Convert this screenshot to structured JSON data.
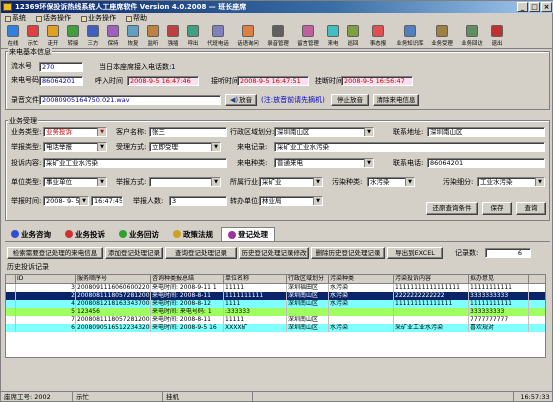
{
  "window": {
    "title": "12369环保投诉热线系统人工座席软件 Version 4.0.2008 — 班长座席",
    "min": "_",
    "max": "□",
    "close": "×"
  },
  "menu": [
    {
      "label": "系统"
    },
    {
      "label": "话务操作"
    },
    {
      "label": "业务操作"
    },
    {
      "label": "帮助"
    }
  ],
  "toolbar": [
    {
      "label": "在线",
      "color": "#3080e0"
    },
    {
      "label": "示忙",
      "color": "#e04040"
    },
    {
      "label": "走开",
      "color": "#e0a020"
    },
    {
      "label": "转接",
      "color": "#40a040"
    },
    {
      "label": "三方",
      "color": "#4060c0"
    },
    {
      "label": "保持",
      "color": "#a060c0"
    },
    {
      "label": "恢复",
      "color": "#60a0c0"
    },
    {
      "label": "监听",
      "color": "#c08040"
    },
    {
      "label": "强插",
      "color": "#c04040"
    },
    {
      "label": "呼出",
      "color": "#40a080"
    },
    {
      "label": "代班电话",
      "color": "#8080c0"
    },
    {
      "label": "话语询问",
      "color": "#e08040"
    },
    {
      "label": "录音管理",
      "color": "#606060"
    },
    {
      "label": "留言管理",
      "color": "#c060a0"
    },
    {
      "label": "来电",
      "color": "#40c0c0"
    },
    {
      "label": "巡回",
      "color": "#80a040"
    },
    {
      "label": "事态报",
      "color": "#e05050"
    },
    {
      "label": "业务知识库",
      "color": "#5080c0"
    },
    {
      "label": "业务受理",
      "color": "#a08040"
    },
    {
      "label": "业务回访",
      "color": "#609060"
    },
    {
      "label": "退出",
      "color": "#c03030"
    }
  ],
  "callinfo": {
    "group_label": "来电基本信息",
    "queue_label": "流水号",
    "queue_value": "270",
    "today_label": "当日本座席接入电话数:",
    "today_value": "1",
    "caller_label": "来电号码",
    "caller_value": "86064201",
    "in_label": "呼入时间",
    "in_value": "2008-9-5 16:47:46",
    "ans_label": "接听时间",
    "ans_value": "2008-9-5 16:47:51",
    "hang_label": "挂断时间",
    "hang_value": "2008-9-5 16:56:47",
    "rec_label": "录音文件",
    "rec_value": "20080905164750.021.wav",
    "play_label": "放音",
    "hint": "(注:放音前请先摘机)",
    "stop_label": "停止放音",
    "clear_label": "清除来电信息"
  },
  "accept": {
    "group_label": "业务受理",
    "type_label": "业务类型:",
    "type_value": "业务投诉",
    "client_label": "客户名称:",
    "client_value": "张三",
    "area_label": "行政区域划分:",
    "area_value": "深圳南山区",
    "addr_label": "联系地址:",
    "addr_value": "深圳南山区",
    "rtype_label": "举报类型:",
    "rtype_value": "电话举报",
    "acc_label": "受理方式:",
    "acc_value": "立即受理",
    "record_label": "来电记录:",
    "record_value": "采矿业工业水污染",
    "content_label": "投诉内容:",
    "content_value": "采矿业工业水污染",
    "ctype_label": "来电种类:",
    "ctype_value": "普通来电",
    "phone_label": "联系电话:",
    "phone_value": "86064201",
    "unit_label": "单位类型:",
    "unit_value": "事业单位",
    "rway_label": "举报方式:",
    "rway_value": "",
    "ind_label": "所属行业:",
    "ind_value": "采矿业",
    "poll_label": "污染种类:",
    "poll_value": "水污染",
    "sub_label": "污染细分:",
    "sub_value": "工业水污染",
    "time_label": "举报时间:",
    "date_value": "2008- 9- 5",
    "clock_value": "16:47:45",
    "count_label": "举报人数:",
    "count_value": "3",
    "dept_label": "转办单位:",
    "dept_value": "林业局",
    "reset_label": "还原查询条件",
    "save_label": "保存",
    "query_label": "查询"
  },
  "tabs": [
    {
      "label": "业务咨询",
      "color": "#3050d0"
    },
    {
      "label": "业务投诉",
      "color": "#d03030"
    },
    {
      "label": "业务回访",
      "color": "#30a030"
    },
    {
      "label": "政策法规",
      "color": "#d0a020"
    },
    {
      "label": "登记处理",
      "color": "#a030a0"
    }
  ],
  "actions": {
    "b1": "检索需要登记处理的来电信息",
    "b2": "添加登记处理记录",
    "b3": "查询登记处理记录",
    "b4": "历史登记处理记录修改",
    "b5": "删除历史登记处理记录",
    "b6": "导出到EXCEL",
    "count_label": "记录数:",
    "count_value": "6"
  },
  "grid": {
    "group_label": "历史投诉记录",
    "headers": [
      "ID",
      "服务顺序号",
      "咨询种类报总结",
      "单位名称",
      "行政区域划分",
      "污染种类",
      "污染投诉内容",
      "拟办意见"
    ],
    "rows": [
      {
        "bg": "#ffffff",
        "cells": [
          "",
          "3",
          "200809111606060022002",
          "来电时间: 2008-9-11 1",
          "11111",
          "深圳福田区",
          "水污染",
          "11111111111111111",
          "11111111111"
        ]
      },
      {
        "bg": "#0a246a",
        "fg": "#ffffff",
        "cells": [
          "",
          "2",
          "20080811180572812002",
          "来电时间: 2008-8-11",
          "1111111111",
          "深圳南山区",
          "水污染",
          "2222222222222",
          "3333333333"
        ]
      },
      {
        "bg": "#80ffff",
        "cells": [
          "",
          "4",
          "20080812181633437002",
          "来电时间: 2008-8-12",
          "1111",
          "深圳南山区",
          "水污染",
          "111111111111111",
          "11111111111"
        ]
      },
      {
        "bg": "#a0ff60",
        "cells": [
          "",
          "5",
          "123456",
          "来电时间: 来电号码: 1",
          ":333333",
          "",
          "",
          "",
          "333333333"
        ]
      },
      {
        "bg": "#ffffff",
        "cells": [
          "",
          "7",
          "20080811180572812002",
          "来电时间: 2008-8-11",
          "11111",
          "深圳南山区",
          "",
          "",
          "7777777777"
        ]
      },
      {
        "bg": "#80ffff",
        "cells": [
          "",
          "6",
          "20080905165122343200",
          "来电时间: 2008-9-5 16",
          "XXXX矿",
          "深圳南山区",
          "水污染",
          "采矿业工业水污染",
          "喜欢规对"
        ]
      }
    ]
  },
  "status": {
    "agent": "座席工号: 2002",
    "state": "示忙",
    "hook": "挂机",
    "time": "16:57:33"
  }
}
